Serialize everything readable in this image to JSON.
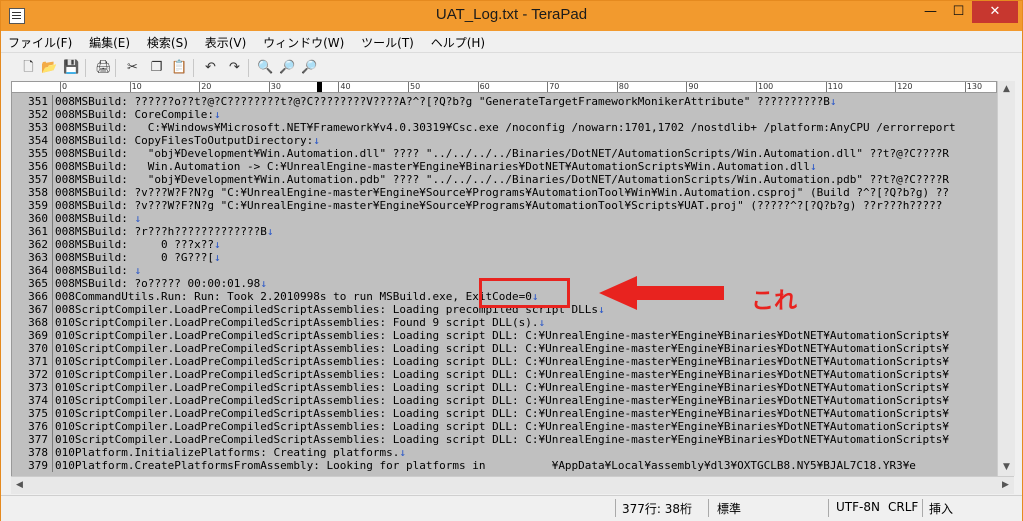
{
  "window": {
    "title": "UAT_Log.txt - TeraPad"
  },
  "window_controls": {
    "minimize": "—",
    "maximize": "☐",
    "close": "✕"
  },
  "menu": [
    "ファイル(F)",
    "編集(E)",
    "検索(S)",
    "表示(V)",
    "ウィンドウ(W)",
    "ツール(T)",
    "ヘルプ(H)"
  ],
  "toolbar": [
    {
      "name": "new-file-icon",
      "glyph": "🗋"
    },
    {
      "name": "open-folder-icon",
      "glyph": "📂"
    },
    {
      "name": "save-icon",
      "glyph": "💾"
    },
    {
      "name": "print-icon",
      "glyph": "🖨"
    },
    {
      "name": "cut-icon",
      "glyph": "✂"
    },
    {
      "name": "copy-icon",
      "glyph": "❐"
    },
    {
      "name": "paste-icon",
      "glyph": "📋"
    },
    {
      "name": "undo-icon",
      "glyph": "↶"
    },
    {
      "name": "redo-icon",
      "glyph": "↷"
    },
    {
      "name": "find-icon",
      "glyph": "🔍"
    },
    {
      "name": "find-next-icon",
      "glyph": "🔎"
    },
    {
      "name": "find-prev-icon",
      "glyph": "🔎"
    }
  ],
  "ruler": [
    "0",
    "10",
    "20",
    "30",
    "40",
    "50",
    "60",
    "70",
    "80",
    "90",
    "100",
    "110",
    "120",
    "130",
    "140"
  ],
  "return_mark": "↓",
  "lines": [
    {
      "n": "351",
      "t": "008MSBuild: ??????o??t?@?C????????t?@?C????????V????A?^?[?Q?b?g \"GenerateTargetFrameworkMonikerAttribute\" ??????????B",
      "r": true
    },
    {
      "n": "352",
      "t": "008MSBuild: CoreCompile:",
      "r": true
    },
    {
      "n": "353",
      "t": "008MSBuild:   C:¥Windows¥Microsoft.NET¥Framework¥v4.0.30319¥Csc.exe /noconfig /nowarn:1701,1702 /nostdlib+ /platform:AnyCPU /errorreport",
      "r": false
    },
    {
      "n": "354",
      "t": "008MSBuild: CopyFilesToOutputDirectory:",
      "r": true
    },
    {
      "n": "355",
      "t": "008MSBuild:   \"obj¥Development¥Win.Automation.dll\" ???? \"../../../../Binaries/DotNET/AutomationScripts/Win.Automation.dll\" ??t?@?C????R",
      "r": false
    },
    {
      "n": "356",
      "t": "008MSBuild:   Win.Automation -> C:¥UnrealEngine-master¥Engine¥Binaries¥DotNET¥AutomationScripts¥Win.Automation.dll",
      "r": true
    },
    {
      "n": "357",
      "t": "008MSBuild:   \"obj¥Development¥Win.Automation.pdb\" ???? \"../../../../Binaries/DotNET/AutomationScripts/Win.Automation.pdb\" ??t?@?C????R",
      "r": false
    },
    {
      "n": "358",
      "t": "008MSBuild: ?v???W?F?N?g \"C:¥UnrealEngine-master¥Engine¥Source¥Programs¥AutomationTool¥Win¥Win.Automation.csproj\" (Build ?^?[?Q?b?g) ??",
      "r": false
    },
    {
      "n": "359",
      "t": "008MSBuild: ?v???W?F?N?g \"C:¥UnrealEngine-master¥Engine¥Source¥Programs¥AutomationTool¥Scripts¥UAT.proj\" (?????^?[?Q?b?g) ??r???h?????",
      "r": false
    },
    {
      "n": "360",
      "t": "008MSBuild: ",
      "r": true
    },
    {
      "n": "361",
      "t": "008MSBuild: ?r???h?????????????B",
      "r": true
    },
    {
      "n": "362",
      "t": "008MSBuild:     0 ???x??",
      "r": true
    },
    {
      "n": "363",
      "t": "008MSBuild:     0 ?G???[",
      "r": true
    },
    {
      "n": "364",
      "t": "008MSBuild: ",
      "r": true
    },
    {
      "n": "365",
      "t": "008MSBuild: ?o????? 00:00:01.98",
      "r": true
    },
    {
      "n": "366",
      "t": "008CommandUtils.Run: Run: Took 2.2010998s to run MSBuild.exe, ExitCode=0",
      "r": true
    },
    {
      "n": "367",
      "t": "008ScriptCompiler.LoadPreCompiledScriptAssemblies: Loading precompiled script DLLs",
      "r": true
    },
    {
      "n": "368",
      "t": "010ScriptCompiler.LoadPreCompiledScriptAssemblies: Found 9 script DLL(s).",
      "r": true
    },
    {
      "n": "369",
      "t": "010ScriptCompiler.LoadPreCompiledScriptAssemblies: Loading script DLL: C:¥UnrealEngine-master¥Engine¥Binaries¥DotNET¥AutomationScripts¥",
      "r": false
    },
    {
      "n": "370",
      "t": "010ScriptCompiler.LoadPreCompiledScriptAssemblies: Loading script DLL: C:¥UnrealEngine-master¥Engine¥Binaries¥DotNET¥AutomationScripts¥",
      "r": false
    },
    {
      "n": "371",
      "t": "010ScriptCompiler.LoadPreCompiledScriptAssemblies: Loading script DLL: C:¥UnrealEngine-master¥Engine¥Binaries¥DotNET¥AutomationScripts¥",
      "r": false
    },
    {
      "n": "372",
      "t": "010ScriptCompiler.LoadPreCompiledScriptAssemblies: Loading script DLL: C:¥UnrealEngine-master¥Engine¥Binaries¥DotNET¥AutomationScripts¥",
      "r": false
    },
    {
      "n": "373",
      "t": "010ScriptCompiler.LoadPreCompiledScriptAssemblies: Loading script DLL: C:¥UnrealEngine-master¥Engine¥Binaries¥DotNET¥AutomationScripts¥",
      "r": false
    },
    {
      "n": "374",
      "t": "010ScriptCompiler.LoadPreCompiledScriptAssemblies: Loading script DLL: C:¥UnrealEngine-master¥Engine¥Binaries¥DotNET¥AutomationScripts¥",
      "r": false
    },
    {
      "n": "375",
      "t": "010ScriptCompiler.LoadPreCompiledScriptAssemblies: Loading script DLL: C:¥UnrealEngine-master¥Engine¥Binaries¥DotNET¥AutomationScripts¥",
      "r": false
    },
    {
      "n": "376",
      "t": "010ScriptCompiler.LoadPreCompiledScriptAssemblies: Loading script DLL: C:¥UnrealEngine-master¥Engine¥Binaries¥DotNET¥AutomationScripts¥",
      "r": false
    },
    {
      "n": "377",
      "t": "010ScriptCompiler.LoadPreCompiledScriptAssemblies: Loading script DLL: C:¥UnrealEngine-master¥Engine¥Binaries¥DotNET¥AutomationScripts¥",
      "r": false
    },
    {
      "n": "378",
      "t": "010Platform.InitializePlatforms: Creating platforms.",
      "r": true
    },
    {
      "n": "379",
      "t": "010Platform.CreatePlatformsFromAssembly: Looking for platforms in          ¥AppData¥Local¥assembly¥dl3¥OXTGCLB8.NY5¥BJAL7C18.YR3¥e",
      "r": false
    }
  ],
  "status": {
    "position": "377行:  38桁",
    "mode": "標準",
    "encoding": "UTF-8N",
    "newline": "CRLF",
    "insert": "挿入"
  },
  "annotation": {
    "label": "これ",
    "color": "#e8231f"
  }
}
